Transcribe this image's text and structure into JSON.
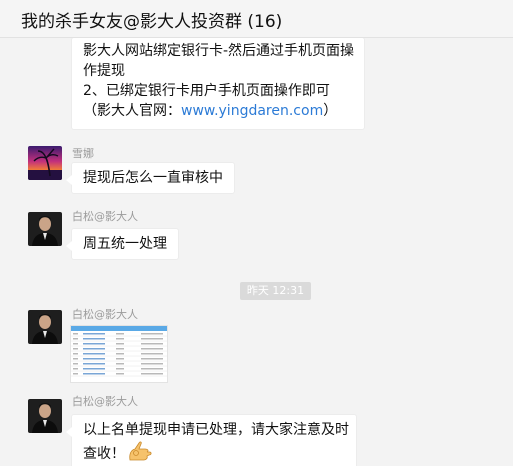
{
  "window": {
    "title": "我的杀手女友@影大人投资群 (16)"
  },
  "messages": [
    {
      "type": "text",
      "lines": [
        "影大人网站绑定银行卡-然后通过手机页面操",
        "作提现",
        " 2、已绑定银行卡用户手机页面操作即可",
        "（影大人官网："
      ],
      "link": "www.yingdaren.com",
      "link_suffix": "）"
    },
    {
      "type": "text",
      "sender": "雪娜",
      "avatar": "sunset-palm-avatar",
      "text": "提现后怎么一直审核中"
    },
    {
      "type": "text",
      "sender": "白松@影大人",
      "avatar": "man-suit-avatar",
      "text": "周五统一处理"
    },
    {
      "type": "time",
      "text": "昨天 12:31"
    },
    {
      "type": "image",
      "sender": "白松@影大人",
      "avatar": "man-suit-avatar",
      "image": "spreadsheet-screenshot"
    },
    {
      "type": "text",
      "sender": "白松@影大人",
      "avatar": "man-suit-avatar",
      "lines": [
        "以上名单提现申请已处理，请大家注意及时",
        "查收！"
      ],
      "emoji": "ok-hand-emoji"
    }
  ]
}
